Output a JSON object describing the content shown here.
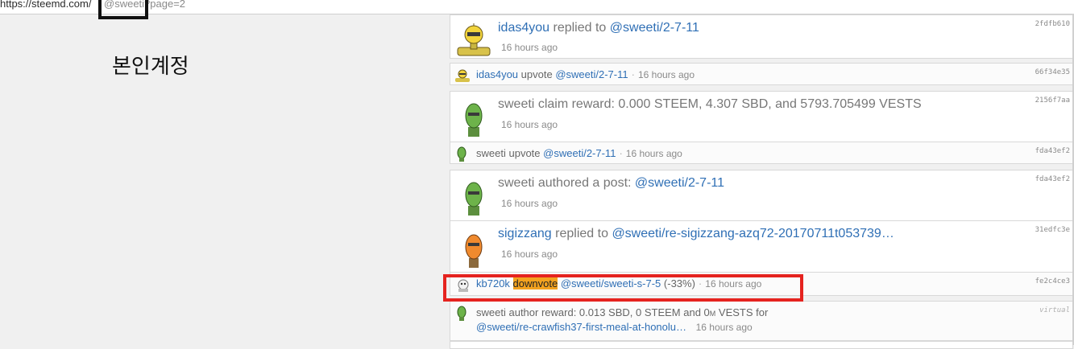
{
  "url": {
    "host": "https://steemd.com/",
    "path": "@sweeti?page=2"
  },
  "owner_label": "본인계정",
  "feed": [
    {
      "hash": "2fdfb610",
      "user": "idas4you",
      "verb": "replied to",
      "link": "@sweeti/2-7-11",
      "time": "16 hours ago",
      "avatar": "yellow-robot"
    },
    {
      "hash": "66f34e35",
      "user": "idas4you",
      "verb": "upvote",
      "link": "@sweeti/2-7-11",
      "time": "16 hours ago",
      "avatar": "yellow-robot"
    },
    {
      "hash": "2156f7aa",
      "user": "sweeti",
      "text": "claim reward: 0.000 STEEM, 4.307 SBD, and 5793.705499 VESTS",
      "time": "16 hours ago",
      "avatar": "green-robot"
    },
    {
      "hash": "fda43ef2",
      "user": "sweeti",
      "verb": "upvote",
      "link": "@sweeti/2-7-11",
      "time": "16 hours ago",
      "avatar": "green-robot"
    },
    {
      "hash": "fda43ef2",
      "user": "sweeti",
      "verb": "authored a post:",
      "link": "@sweeti/2-7-11",
      "time": "16 hours ago",
      "avatar": "green-robot"
    },
    {
      "hash": "31edfc3e",
      "user": "sigizzang",
      "verb": "replied to",
      "link": "@sweeti/re-sigizzang-azq72-20170711t053739…",
      "time": "16 hours ago",
      "avatar": "orange-robot"
    },
    {
      "hash": "fe2c4ce3",
      "user": "kb720k",
      "verb": "downvote",
      "link": "@sweeti/sweeti-s-7-5",
      "extra": "(-33%)",
      "time": "16 hours ago",
      "avatar": "skull-robot"
    },
    {
      "hash": "virtual",
      "user": "sweeti",
      "text1": "author reward: 0.013 SBD, 0 STEEM and 0",
      "text_m": "M",
      "text2": "VESTS for",
      "link": "@sweeti/re-crawfish37-first-meal-at-honolu…",
      "time": "16 hours ago",
      "avatar": "green-robot"
    }
  ],
  "colors": {
    "link": "#2f6fb5",
    "downvote_highlight": "#f3a21f",
    "annotation_red": "#e5231f"
  }
}
